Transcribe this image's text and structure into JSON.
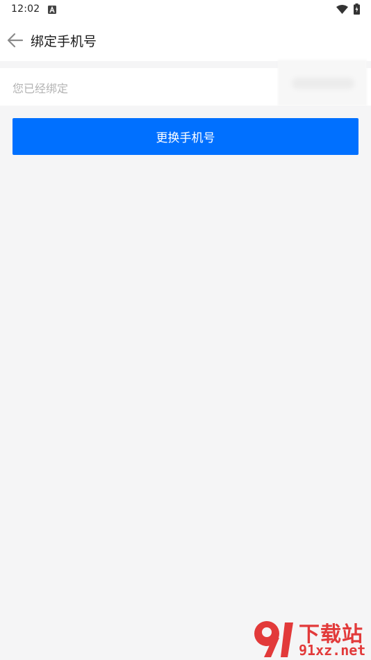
{
  "status_bar": {
    "time": "12:02",
    "icons": [
      "a-notification-icon",
      "wifi-icon",
      "battery-charging-icon"
    ]
  },
  "app_bar": {
    "title": "绑定手机号",
    "back_icon": "arrow-left-icon"
  },
  "bound_info": {
    "label": "您已经绑定"
  },
  "actions": {
    "change_phone_label": "更换手机号"
  },
  "watermark": {
    "text_top": "下载站",
    "text_bottom": "91xz.net"
  },
  "colors": {
    "primary": "#0070ff",
    "background": "#f5f5f6",
    "watermark": "#e23a3a"
  }
}
